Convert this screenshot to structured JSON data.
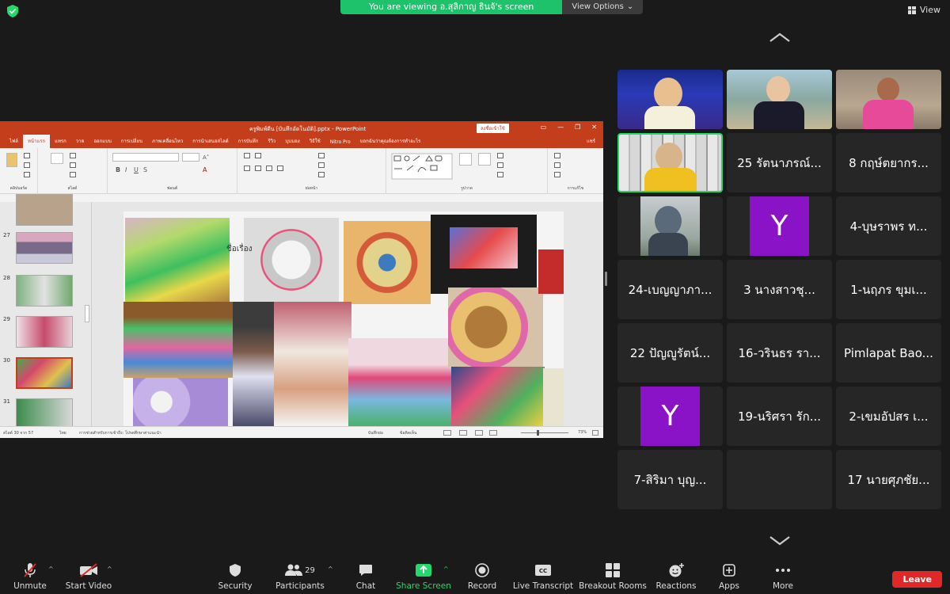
{
  "banner": {
    "message": "You are viewing อ.สุลิกาญ ธินจ้'s screen",
    "view_options": "View Options"
  },
  "view_button": "View",
  "ppt": {
    "title": "ครูพิมพ์ดีน [บันทึกอัตโนมัติ].pptx - PowerPoint",
    "signin": "ลงชื่อเข้าใช้",
    "tabs": [
      "ไฟล์",
      "หน้าแรก",
      "แทรก",
      "วาด",
      "ออกแบบ",
      "การเปลี่ยน",
      "ภาพเคลื่อนไหว",
      "การนำเสนอสไลด์",
      "การบันทึก",
      "รีวิว",
      "มุมมอง",
      "วิธีใช้",
      "Nitro Pro",
      "บอกฉันว่าคุณต้องการทำอะไร"
    ],
    "share": "แชร์",
    "groups": [
      "คลิปบอร์ด",
      "สไลด์",
      "ฟอนต์",
      "ย่อหน้า",
      "รูปวาด",
      "การแก้ไข"
    ],
    "thumb_numbers": [
      "27",
      "28",
      "29",
      "30",
      "31"
    ],
    "slide_text": "ชื่อเรื่อง",
    "status_left": "สไลด์ 30 จาก 57",
    "status_lang": "ไทย",
    "status_access": "การช่วยสำหรับการเข้าถึง: โปรดศึกษาค่าแนะนำ",
    "status_notes": "บันทึกย่อ",
    "status_comments": "ข้อคิดเห็น",
    "zoom": "73%"
  },
  "participants": [
    {
      "name": "",
      "type": "video"
    },
    {
      "name": "",
      "type": "video"
    },
    {
      "name": "",
      "type": "video"
    },
    {
      "name": "",
      "type": "video"
    },
    {
      "name": "25 รัตนาภรณ์...",
      "type": "name"
    },
    {
      "name": "8 กฤษ์ตยากร...",
      "type": "name"
    },
    {
      "name": "",
      "type": "video"
    },
    {
      "name": "Y",
      "type": "avatar"
    },
    {
      "name": "4-บุษราพร ท...",
      "type": "name"
    },
    {
      "name": "24-เบญญาภา...",
      "type": "name"
    },
    {
      "name": "3 นางสาวชุ...",
      "type": "name"
    },
    {
      "name": "1-นฤภร ขุมเ...",
      "type": "name"
    },
    {
      "name": "22 ปัญญูรัตน์...",
      "type": "name"
    },
    {
      "name": "16-วรินธร รา...",
      "type": "name"
    },
    {
      "name": "Pimlapat Bao...",
      "type": "name"
    },
    {
      "name": "Y",
      "type": "avatar"
    },
    {
      "name": "19-นริศรา รัก...",
      "type": "name"
    },
    {
      "name": "2-เขมอัปสร เ...",
      "type": "name"
    },
    {
      "name": "7-สิริมา บุญ...",
      "type": "name"
    },
    {
      "name": "",
      "type": "blank"
    },
    {
      "name": "17 นายศุภชัย...",
      "type": "name"
    }
  ],
  "toolbar": {
    "unmute": "Unmute",
    "start_video": "Start Video",
    "security": "Security",
    "participants": "Participants",
    "participants_count": "29",
    "chat": "Chat",
    "share_screen": "Share Screen",
    "record": "Record",
    "live_transcript": "Live Transcript",
    "breakout_rooms": "Breakout Rooms",
    "reactions": "Reactions",
    "apps": "Apps",
    "more": "More",
    "leave": "Leave"
  },
  "colors": {
    "banner_green": "#1ec26a",
    "active_speaker": "#23d96c",
    "ppt_red": "#c43e1c",
    "avatar_purple": "#8a13c8",
    "leave_red": "#e02828"
  }
}
